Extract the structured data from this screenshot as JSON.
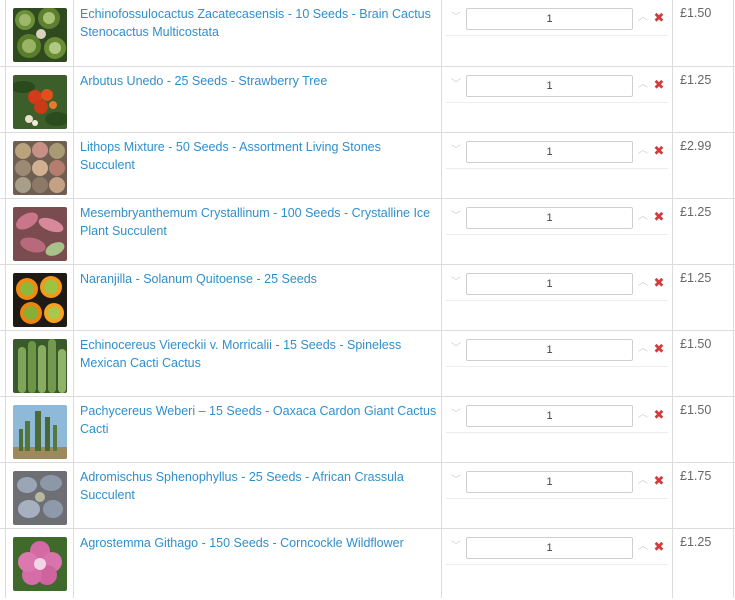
{
  "cart": {
    "rows": [
      {
        "title_line1": "Echinofossulocactus Zacatecasensis - 10 Seeds - Brain Cactus",
        "title_line2": "Stenocactus Multicostata",
        "qty": "1",
        "price": "£1.50",
        "image": "brain-cactus"
      },
      {
        "title_line1": "Arbutus Unedo - 25 Seeds - Strawberry Tree",
        "title_line2": "",
        "qty": "1",
        "price": "£1.25",
        "image": "strawberry-tree"
      },
      {
        "title_line1": "Lithops Mixture - 50 Seeds - Assortment Living Stones",
        "title_line2": "Succulent",
        "qty": "1",
        "price": "£2.99",
        "image": "lithops"
      },
      {
        "title_line1": "Mesembryanthemum Crystallinum - 100 Seeds - Crystalline Ice",
        "title_line2": "Plant Succulent",
        "qty": "1",
        "price": "£1.25",
        "image": "ice-plant"
      },
      {
        "title_line1": "Naranjilla - Solanum Quitoense - 25 Seeds",
        "title_line2": "",
        "qty": "1",
        "price": "£1.25",
        "image": "naranjilla"
      },
      {
        "title_line1": "Echinocereus Viereckii v. Morricalii - 15 Seeds - Spineless",
        "title_line2": "Mexican Cacti Cactus",
        "qty": "1",
        "price": "£1.50",
        "image": "echinocereus"
      },
      {
        "title_line1": "Pachycereus Weberi – 15 Seeds - Oaxaca Cardon Giant Cactus",
        "title_line2": "Cacti",
        "qty": "1",
        "price": "£1.50",
        "image": "pachycereus"
      },
      {
        "title_line1": "Adromischus Sphenophyllus - 25 Seeds - African Crassula",
        "title_line2": "Succulent",
        "qty": "1",
        "price": "£1.75",
        "image": "adromischus"
      },
      {
        "title_line1": "Agrostemma Githago - 150 Seeds - Corncockle Wildflower",
        "title_line2": "",
        "qty": "1",
        "price": "£1.25",
        "image": "corncockle"
      }
    ]
  },
  "colors": {
    "link": "#2f8fcc",
    "remove": "#d23b3b",
    "border": "#dcdcdc"
  }
}
